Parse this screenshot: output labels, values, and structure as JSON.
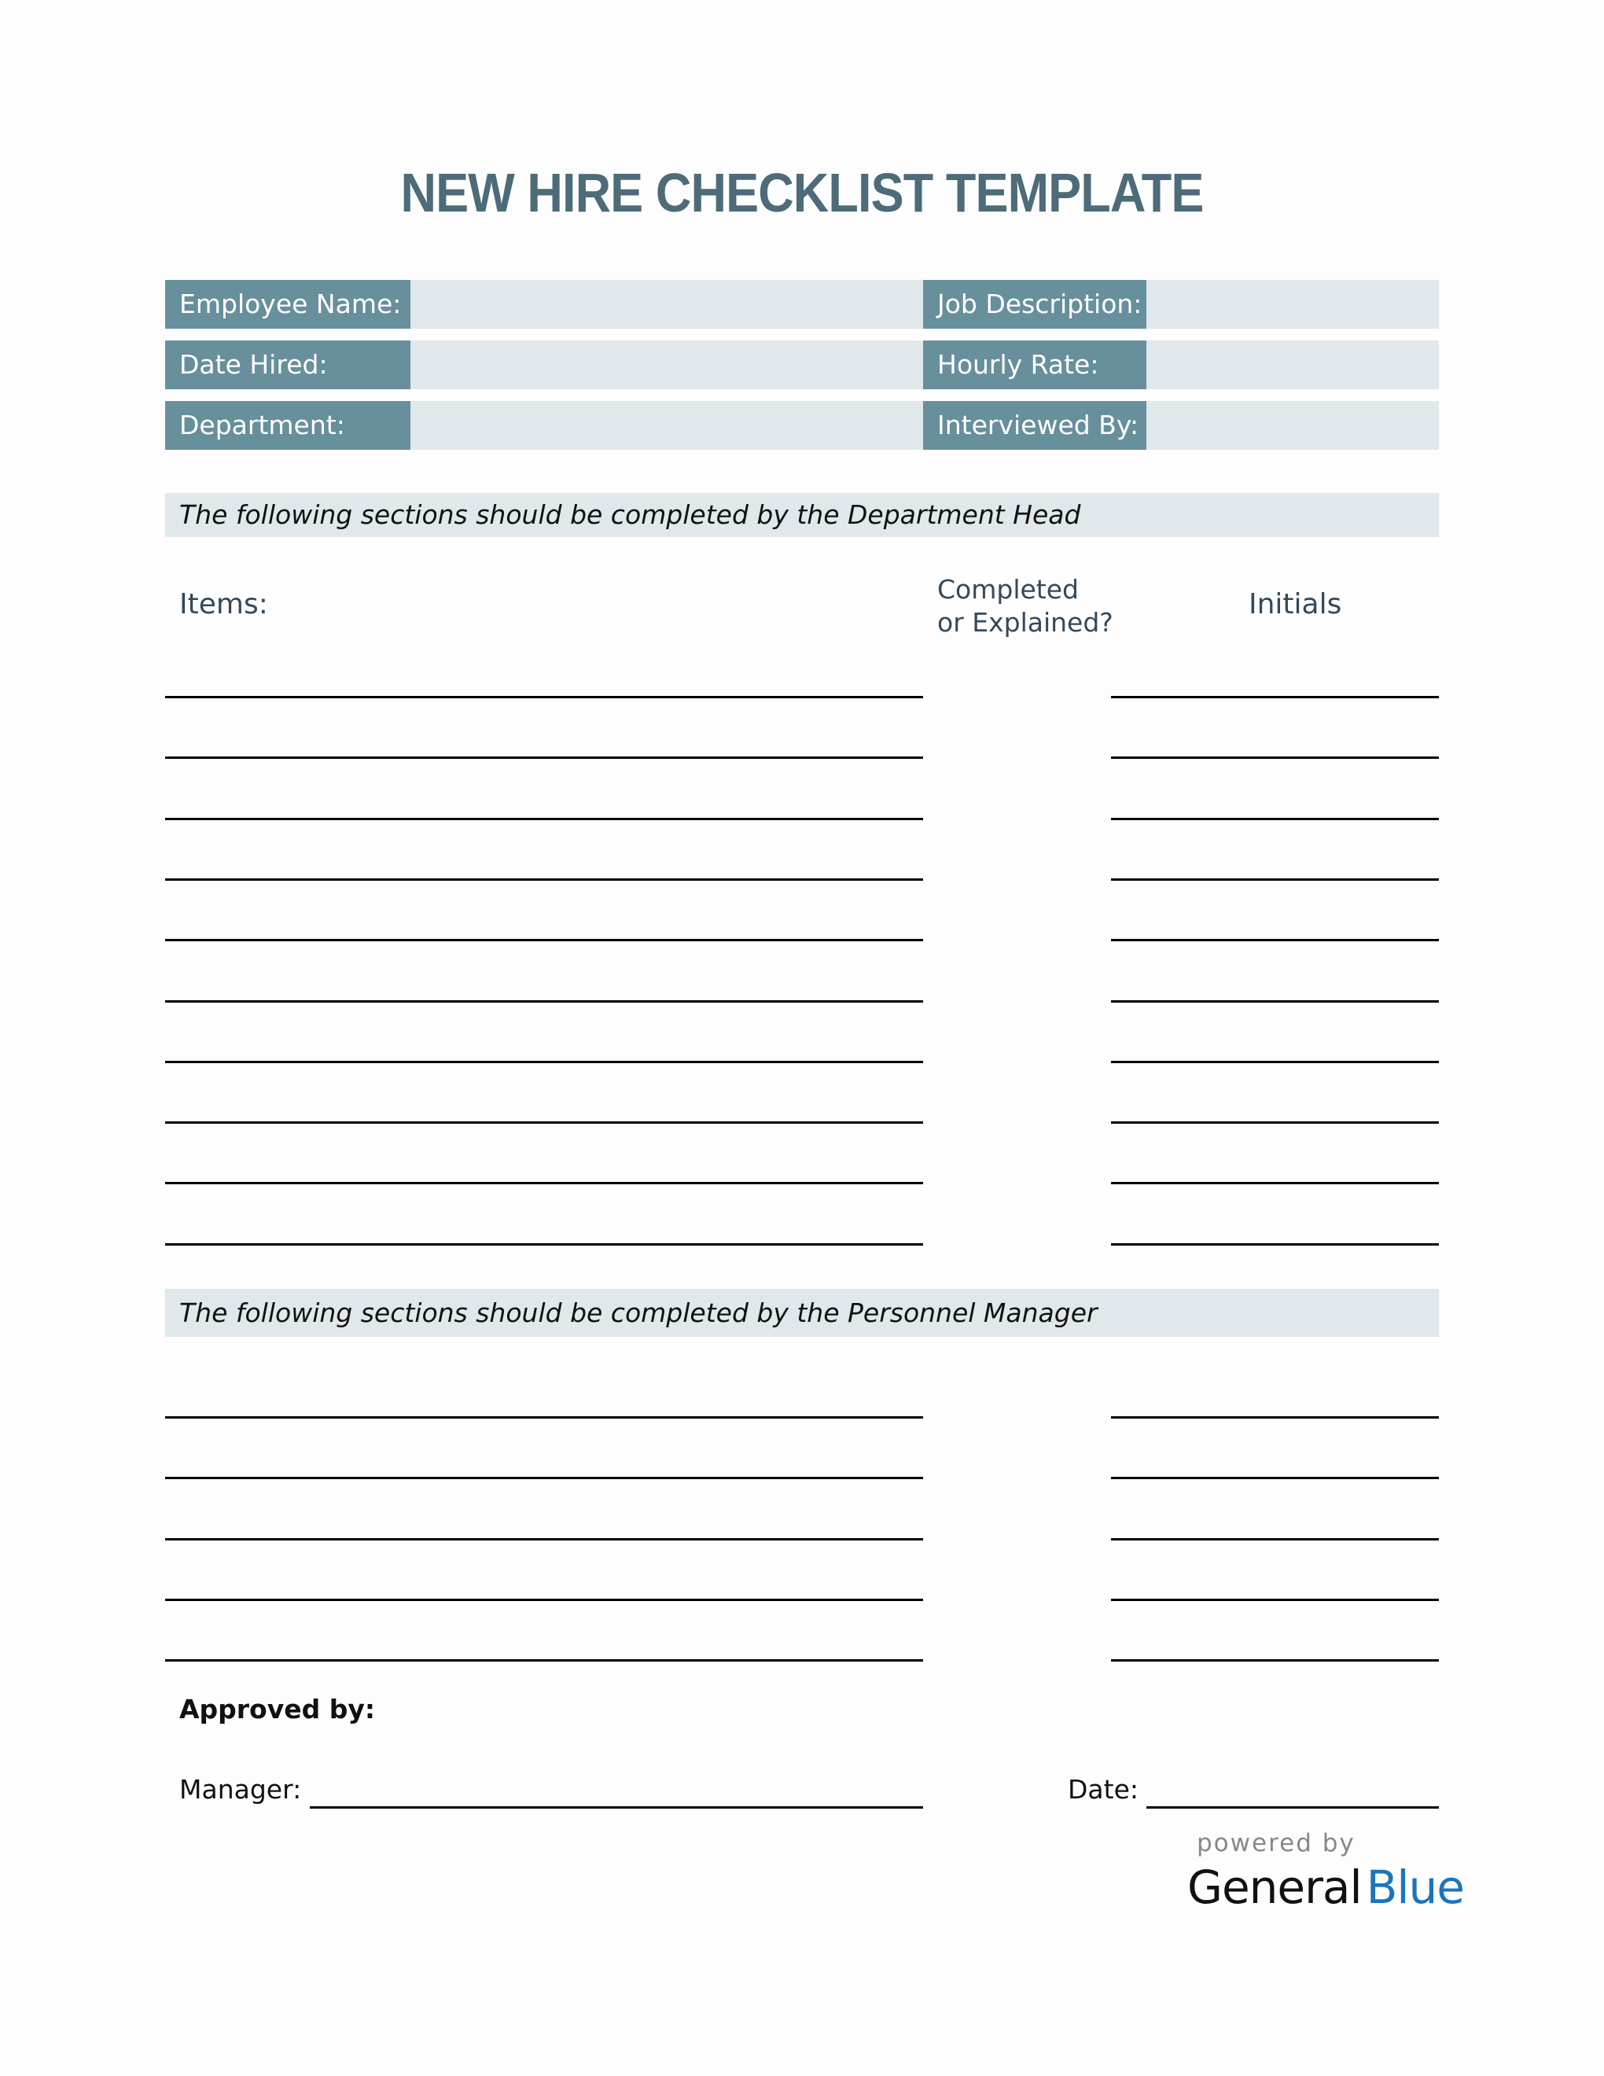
{
  "document": {
    "title": "NEW HIRE CHECKLIST TEMPLATE"
  },
  "colors": {
    "title": "#4d6b78",
    "label_bg": "#678f9c",
    "field_bg": "#e0e8eb",
    "header_text": "#34495a",
    "brand_blue": "#1b75bb"
  },
  "info_fields": [
    {
      "left": {
        "label": "Employee Name:",
        "value": ""
      },
      "right": {
        "label": "Job Description:",
        "value": ""
      }
    },
    {
      "left": {
        "label": "Date Hired:",
        "value": ""
      },
      "right": {
        "label": "Hourly Rate:",
        "value": ""
      }
    },
    {
      "left": {
        "label": "Department:",
        "value": ""
      },
      "right": {
        "label": "Interviewed By:",
        "value": ""
      }
    }
  ],
  "section_department": {
    "banner": "The following sections should be completed by the Department Head",
    "headers": {
      "items": "Items:",
      "completed_line1": "Completed",
      "completed_line2": "or Explained?",
      "initials": "Initials"
    },
    "row_count": 10
  },
  "section_personnel": {
    "banner": "The following sections should be completed by the Personnel Manager",
    "row_count": 5
  },
  "approval": {
    "heading": "Approved by:",
    "manager_label": "Manager:",
    "manager_value": "",
    "date_label": "Date:",
    "date_value": ""
  },
  "branding": {
    "powered_by": "powered by",
    "brand_first": "General",
    "brand_second": "Blue"
  }
}
